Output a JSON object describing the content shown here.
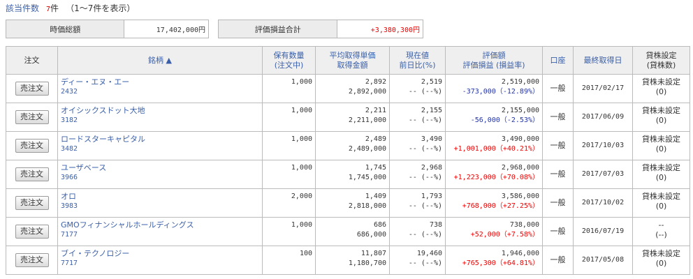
{
  "header": {
    "count_label": "該当件数",
    "count_value": "7",
    "count_unit": "件",
    "range_text": "（1〜7件を表示）"
  },
  "summary": {
    "market_value_label": "時価総額",
    "market_value": "17,402,000円",
    "pl_total_label": "評価損益合計",
    "pl_total": "+3,380,300円"
  },
  "table": {
    "headers": {
      "order": "注文",
      "name": "銘柄 ▲",
      "qty_1": "保有数量",
      "qty_2": "(注文中)",
      "cost_1": "平均取得単価",
      "cost_2": "取得金額",
      "price_1": "現在値",
      "price_2": "前日比(%)",
      "value_1": "評価額",
      "value_2": "評価損益 (損益率)",
      "account": "口座",
      "date": "最終取得日",
      "lend_1": "貸株設定",
      "lend_2": "(貸株数)"
    },
    "rows": [
      {
        "button": "売注文",
        "name": "ディー・エヌ・エー",
        "code": "2432",
        "qty": "1,000",
        "avg_price": "2,892",
        "cost": "2,892,000",
        "price": "2,519",
        "change": "-- (--%)",
        "value": "2,519,000",
        "pl": "-373,000（-12.89%）",
        "pl_sign": "neg",
        "account": "一般",
        "date": "2017/02/17",
        "lend": "貸株未設定",
        "lend_qty": "(0)"
      },
      {
        "button": "売注文",
        "name": "オイシックスドット大地",
        "code": "3182",
        "qty": "1,000",
        "avg_price": "2,211",
        "cost": "2,211,000",
        "price": "2,155",
        "change": "-- (--%)",
        "value": "2,155,000",
        "pl": "-56,000（-2.53%）",
        "pl_sign": "neg",
        "account": "一般",
        "date": "2017/06/09",
        "lend": "貸株未設定",
        "lend_qty": "(0)"
      },
      {
        "button": "売注文",
        "name": "ロードスターキャピタル",
        "code": "3482",
        "qty": "1,000",
        "avg_price": "2,489",
        "cost": "2,489,000",
        "price": "3,490",
        "change": "-- (--%)",
        "value": "3,490,000",
        "pl": "+1,001,000（+40.21%）",
        "pl_sign": "pos",
        "account": "一般",
        "date": "2017/10/03",
        "lend": "貸株未設定",
        "lend_qty": "(0)"
      },
      {
        "button": "売注文",
        "name": "ユーザベース",
        "code": "3966",
        "qty": "1,000",
        "avg_price": "1,745",
        "cost": "1,745,000",
        "price": "2,968",
        "change": "-- (--%)",
        "value": "2,968,000",
        "pl": "+1,223,000（+70.08%）",
        "pl_sign": "pos",
        "account": "一般",
        "date": "2017/07/03",
        "lend": "貸株未設定",
        "lend_qty": "(0)"
      },
      {
        "button": "売注文",
        "name": "オロ",
        "code": "3983",
        "qty": "2,000",
        "avg_price": "1,409",
        "cost": "2,818,000",
        "price": "1,793",
        "change": "-- (--%)",
        "value": "3,586,000",
        "pl": "+768,000（+27.25%）",
        "pl_sign": "pos",
        "account": "一般",
        "date": "2017/10/02",
        "lend": "貸株未設定",
        "lend_qty": "(0)"
      },
      {
        "button": "売注文",
        "name": "GMOフィナンシャルホールディングス",
        "code": "7177",
        "qty": "1,000",
        "avg_price": "686",
        "cost": "686,000",
        "price": "738",
        "change": "-- (--%)",
        "value": "738,000",
        "pl": "+52,000（+7.58%）",
        "pl_sign": "pos",
        "account": "一般",
        "date": "2016/07/19",
        "lend": "--",
        "lend_qty": "(--)"
      },
      {
        "button": "売注文",
        "name": "ブイ・テクノロジー",
        "code": "7717",
        "qty": "100",
        "avg_price": "11,807",
        "cost": "1,180,700",
        "price": "19,460",
        "change": "-- (--%)",
        "value": "1,946,000",
        "pl": "+765,300（+64.81%）",
        "pl_sign": "pos",
        "account": "一般",
        "date": "2017/05/08",
        "lend": "貸株未設定",
        "lend_qty": "(0)"
      }
    ]
  }
}
